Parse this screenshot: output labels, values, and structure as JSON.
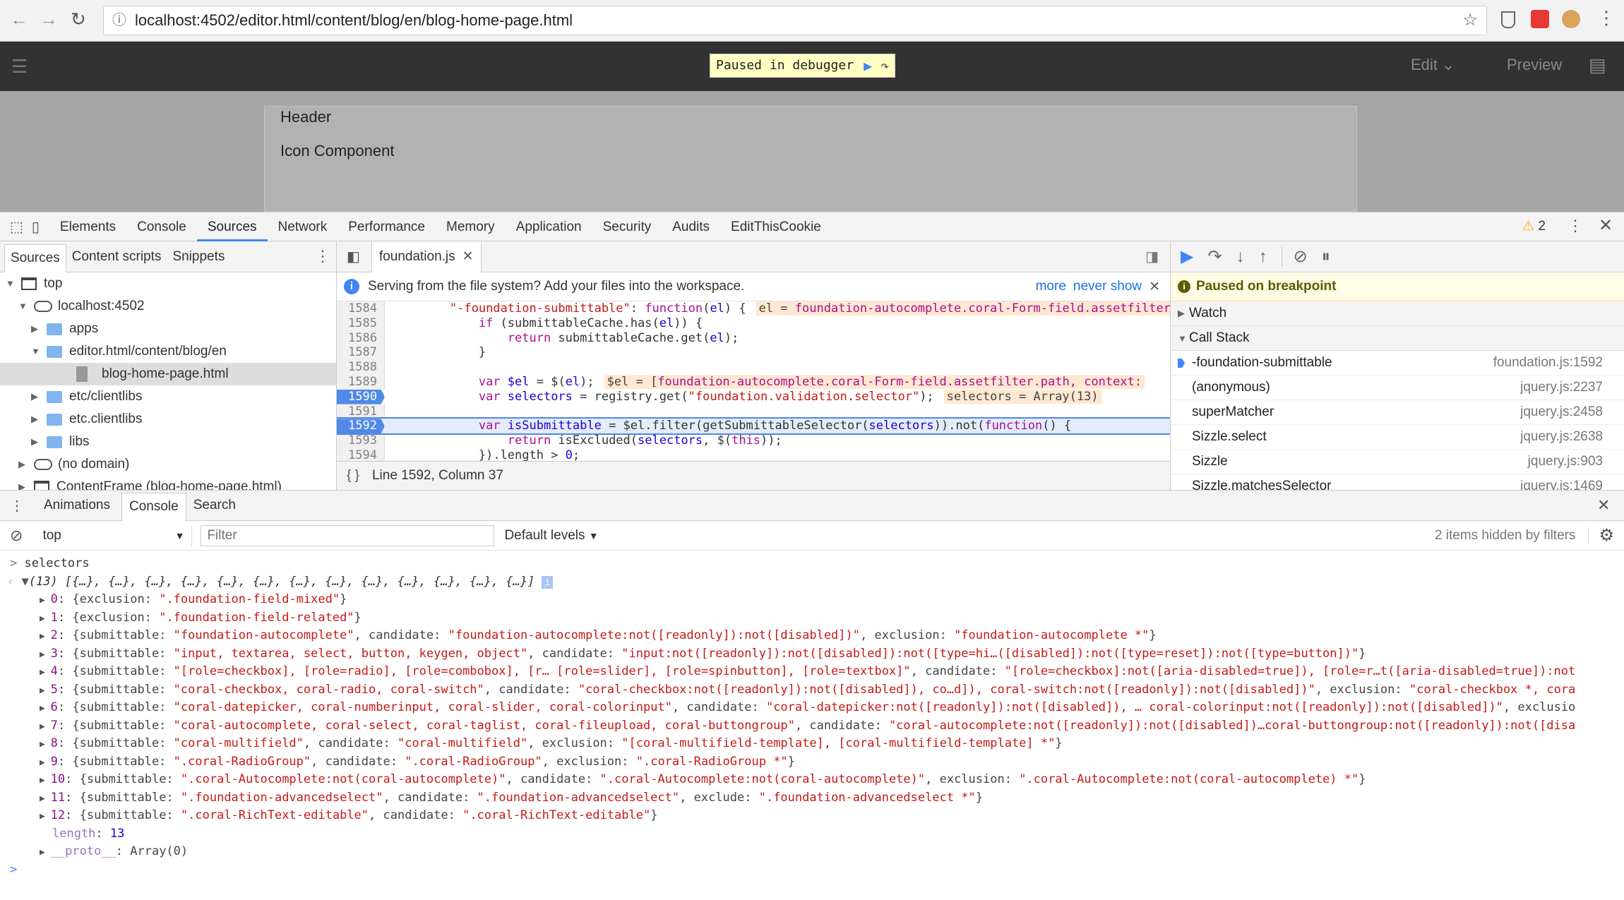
{
  "browser": {
    "url": "localhost:4502/editor.html/content/blog/en/blog-home-page.html"
  },
  "aem": {
    "paused_label": "Paused in debugger",
    "edit_label": "Edit",
    "preview_label": "Preview",
    "page_items": [
      "Header",
      "Icon Component"
    ]
  },
  "devtools": {
    "tabs": [
      "Elements",
      "Console",
      "Sources",
      "Network",
      "Performance",
      "Memory",
      "Application",
      "Security",
      "Audits",
      "EditThisCookie"
    ],
    "active_tab": "Sources",
    "warning_count": "2",
    "navigator": {
      "tabs": [
        "Sources",
        "Content scripts",
        "Snippets"
      ],
      "tree": [
        {
          "label": "top",
          "depth": 0,
          "icon": "window",
          "open": true
        },
        {
          "label": "localhost:4502",
          "depth": 1,
          "icon": "cloud",
          "open": true
        },
        {
          "label": "apps",
          "depth": 2,
          "icon": "folder",
          "open": false
        },
        {
          "label": "editor.html/content/blog/en",
          "depth": 2,
          "icon": "folder",
          "open": true
        },
        {
          "label": "blog-home-page.html",
          "depth": 3,
          "icon": "file",
          "selected": true
        },
        {
          "label": "etc/clientlibs",
          "depth": 2,
          "icon": "folder",
          "open": false
        },
        {
          "label": "etc.clientlibs",
          "depth": 2,
          "icon": "folder",
          "open": false
        },
        {
          "label": "libs",
          "depth": 2,
          "icon": "folder",
          "open": false
        },
        {
          "label": "(no domain)",
          "depth": 1,
          "icon": "cloud",
          "open": false
        },
        {
          "label": "ContentFrame (blog-home-page.html)",
          "depth": 1,
          "icon": "window",
          "open": false
        }
      ]
    },
    "editor": {
      "file_tab": "foundation.js",
      "info": "Serving from the file system? Add your files into the workspace.",
      "info_more": "more",
      "info_never": "never show",
      "status": "Line 1592, Column 37",
      "lines": [
        {
          "n": "1584",
          "segs": [
            [
              "",
              "        "
            ],
            [
              "st",
              "\"-foundation-submittable\""
            ],
            [
              "",
              ": "
            ],
            [
              "kw",
              "function"
            ],
            [
              "",
              "("
            ],
            [
              "vr",
              "el"
            ],
            [
              "",
              ") {"
            ]
          ],
          "inline": [
            "el = ",
            "foundation-autocomplete.coral-Form-field.assetfilter.path"
          ]
        },
        {
          "n": "1585",
          "segs": [
            [
              "",
              "            "
            ],
            [
              "kw",
              "if"
            ],
            [
              "",
              " (submittableCache.has("
            ],
            [
              "vr",
              "el"
            ],
            [
              "",
              ")) {"
            ]
          ]
        },
        {
          "n": "1586",
          "segs": [
            [
              "",
              "                "
            ],
            [
              "kw",
              "return"
            ],
            [
              "",
              " submittableCache.get("
            ],
            [
              "vr",
              "el"
            ],
            [
              "",
              ");"
            ]
          ]
        },
        {
          "n": "1587",
          "segs": [
            [
              "",
              "            }"
            ]
          ]
        },
        {
          "n": "1588",
          "segs": []
        },
        {
          "n": "1589",
          "segs": [
            [
              "",
              "            "
            ],
            [
              "kw",
              "var"
            ],
            [
              "vr",
              " $el"
            ],
            [
              "",
              " = $("
            ],
            [
              "vr",
              "el"
            ],
            [
              "",
              ");"
            ]
          ],
          "inline": [
            "$el = [",
            "foundation-autocomplete.coral-Form-field.assetfilter.path, context:"
          ]
        },
        {
          "n": "1590",
          "bp": true,
          "segs": [
            [
              "",
              "            "
            ],
            [
              "kw",
              "var"
            ],
            [
              "vr",
              " selectors"
            ],
            [
              "",
              " = registry.get("
            ],
            [
              "st",
              "\"foundation.validation.selector\""
            ],
            [
              "",
              ");"
            ]
          ],
          "inline": [
            "selectors = Array(13)",
            ""
          ]
        },
        {
          "n": "1591",
          "segs": []
        },
        {
          "n": "1592",
          "bp": true,
          "current": true,
          "segs": [
            [
              "",
              "            "
            ],
            [
              "kw",
              "var"
            ],
            [
              "vr",
              " isSubmittable"
            ],
            [
              "",
              " = $el.filter(getSubmittableSelector("
            ],
            [
              "vr",
              "selectors"
            ],
            [
              "",
              ")).not("
            ],
            [
              "kw",
              "function"
            ],
            [
              "",
              "() {"
            ]
          ]
        },
        {
          "n": "1593",
          "segs": [
            [
              "",
              "                "
            ],
            [
              "kw",
              "return"
            ],
            [
              "",
              " isExcluded("
            ],
            [
              "vr",
              "selectors"
            ],
            [
              "",
              ", $("
            ],
            [
              "kw",
              "this"
            ],
            [
              "",
              "));"
            ]
          ]
        },
        {
          "n": "1594",
          "segs": [
            [
              "",
              "            }).length > "
            ],
            [
              "nm",
              "0"
            ],
            [
              "",
              ";"
            ]
          ]
        }
      ]
    },
    "debugger": {
      "paused": "Paused on breakpoint",
      "watch": "Watch",
      "call_stack": "Call Stack",
      "frames": [
        {
          "name": "-foundation-submittable",
          "loc": "foundation.js:1592",
          "current": true
        },
        {
          "name": "(anonymous)",
          "loc": "jquery.js:2237"
        },
        {
          "name": "superMatcher",
          "loc": "jquery.js:2458"
        },
        {
          "name": "Sizzle.select",
          "loc": "jquery.js:2638"
        },
        {
          "name": "Sizzle",
          "loc": "jquery.js:903"
        },
        {
          "name": "Sizzle.matchesSelector",
          "loc": "jquery.js:1469"
        }
      ]
    },
    "drawer": {
      "tabs": [
        "Animations",
        "Console",
        "Search"
      ],
      "active": "Console"
    },
    "console": {
      "context": "top",
      "filter_placeholder": "Filter",
      "levels": "Default levels",
      "hidden": "2 items hidden by filters",
      "input": "selectors",
      "summary": "(13) [{…}, {…}, {…}, {…}, {…}, {…}, {…}, {…}, {…}, {…}, {…}, {…}, {…}]",
      "entries": [
        [
          [
            "cp",
            "0"
          ],
          [
            "ck",
            ": {exclusion: "
          ],
          [
            "cs",
            "\".foundation-field-mixed\""
          ],
          [
            "ck",
            "}"
          ]
        ],
        [
          [
            "cp",
            "1"
          ],
          [
            "ck",
            ": {exclusion: "
          ],
          [
            "cs",
            "\".foundation-field-related\""
          ],
          [
            "ck",
            "}"
          ]
        ],
        [
          [
            "cp",
            "2"
          ],
          [
            "ck",
            ": {submittable: "
          ],
          [
            "cs",
            "\"foundation-autocomplete\""
          ],
          [
            "ck",
            ", candidate: "
          ],
          [
            "cs",
            "\"foundation-autocomplete:not([readonly]):not([disabled])\""
          ],
          [
            "ck",
            ", exclusion: "
          ],
          [
            "cs",
            "\"foundation-autocomplete *\""
          ],
          [
            "ck",
            "}"
          ]
        ],
        [
          [
            "cp",
            "3"
          ],
          [
            "ck",
            ": {submittable: "
          ],
          [
            "cs",
            "\"input, textarea, select, button, keygen, object\""
          ],
          [
            "ck",
            ", candidate: "
          ],
          [
            "cs",
            "\"input:not([readonly]):not([disabled]):not([type=hi…([disabled]):not([type=reset]):not([type=button])\""
          ],
          [
            "ck",
            "}"
          ]
        ],
        [
          [
            "cp",
            "4"
          ],
          [
            "ck",
            ": {submittable: "
          ],
          [
            "cs",
            "\"[role=checkbox], [role=radio], [role=combobox], [r… [role=slider], [role=spinbutton], [role=textbox]\""
          ],
          [
            "ck",
            ", candidate: "
          ],
          [
            "cs",
            "\"[role=checkbox]:not([aria-disabled=true]), [role=r…t([aria-disabled=true]):not"
          ]
        ],
        [
          [
            "cp",
            "5"
          ],
          [
            "ck",
            ": {submittable: "
          ],
          [
            "cs",
            "\"coral-checkbox, coral-radio, coral-switch\""
          ],
          [
            "ck",
            ", candidate: "
          ],
          [
            "cs",
            "\"coral-checkbox:not([readonly]):not([disabled]), co…d]), coral-switch:not([readonly]):not([disabled])\""
          ],
          [
            "ck",
            ", exclusion: "
          ],
          [
            "cs",
            "\"coral-checkbox *, cora"
          ]
        ],
        [
          [
            "cp",
            "6"
          ],
          [
            "ck",
            ": {submittable: "
          ],
          [
            "cs",
            "\"coral-datepicker, coral-numberinput, coral-slider, coral-colorinput\""
          ],
          [
            "ck",
            ", candidate: "
          ],
          [
            "cs",
            "\"coral-datepicker:not([readonly]):not([disabled]), … coral-colorinput:not([readonly]):not([disabled])\""
          ],
          [
            "ck",
            ", exclusio"
          ]
        ],
        [
          [
            "cp",
            "7"
          ],
          [
            "ck",
            ": {submittable: "
          ],
          [
            "cs",
            "\"coral-autocomplete, coral-select, coral-taglist, coral-fileupload, coral-buttongroup\""
          ],
          [
            "ck",
            ", candidate: "
          ],
          [
            "cs",
            "\"coral-autocomplete:not([readonly]):not([disabled])…coral-buttongroup:not([readonly]):not([disa"
          ]
        ],
        [
          [
            "cp",
            "8"
          ],
          [
            "ck",
            ": {submittable: "
          ],
          [
            "cs",
            "\"coral-multifield\""
          ],
          [
            "ck",
            ", candidate: "
          ],
          [
            "cs",
            "\"coral-multifield\""
          ],
          [
            "ck",
            ", exclusion: "
          ],
          [
            "cs",
            "\"[coral-multifield-template], [coral-multifield-template] *\""
          ],
          [
            "ck",
            "}"
          ]
        ],
        [
          [
            "cp",
            "9"
          ],
          [
            "ck",
            ": {submittable: "
          ],
          [
            "cs",
            "\".coral-RadioGroup\""
          ],
          [
            "ck",
            ", candidate: "
          ],
          [
            "cs",
            "\".coral-RadioGroup\""
          ],
          [
            "ck",
            ", exclusion: "
          ],
          [
            "cs",
            "\".coral-RadioGroup *\""
          ],
          [
            "ck",
            "}"
          ]
        ],
        [
          [
            "cp",
            "10"
          ],
          [
            "ck",
            ": {submittable: "
          ],
          [
            "cs",
            "\".coral-Autocomplete:not(coral-autocomplete)\""
          ],
          [
            "ck",
            ", candidate: "
          ],
          [
            "cs",
            "\".coral-Autocomplete:not(coral-autocomplete)\""
          ],
          [
            "ck",
            ", exclusion: "
          ],
          [
            "cs",
            "\".coral-Autocomplete:not(coral-autocomplete) *\""
          ],
          [
            "ck",
            "}"
          ]
        ],
        [
          [
            "cp",
            "11"
          ],
          [
            "ck",
            ": {submittable: "
          ],
          [
            "cs",
            "\".foundation-advancedselect\""
          ],
          [
            "ck",
            ", candidate: "
          ],
          [
            "cs",
            "\".foundation-advancedselect\""
          ],
          [
            "ck",
            ", exclude: "
          ],
          [
            "cs",
            "\".foundation-advancedselect *\""
          ],
          [
            "ck",
            "}"
          ]
        ],
        [
          [
            "cp",
            "12"
          ],
          [
            "ck",
            ": {submittable: "
          ],
          [
            "cs",
            "\".coral-RichText-editable\""
          ],
          [
            "ck",
            ", candidate: "
          ],
          [
            "cs",
            "\".coral-RichText-editable\""
          ],
          [
            "ck",
            "}"
          ]
        ]
      ],
      "length_key": "length",
      "length_val": "13",
      "proto_key": "__proto__",
      "proto_val": ": Array(0)"
    }
  }
}
